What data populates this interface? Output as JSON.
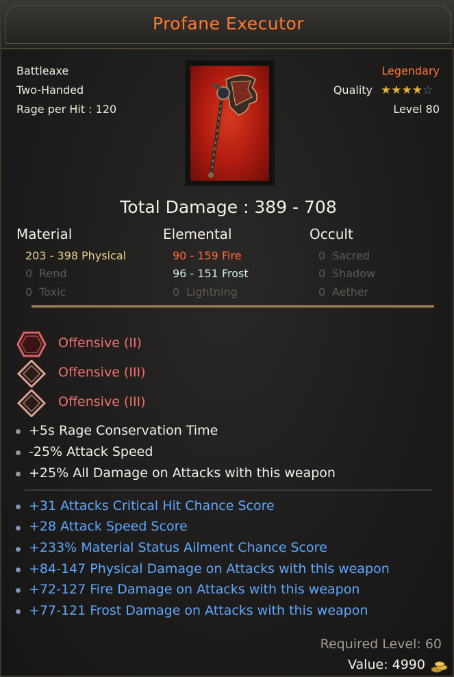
{
  "title": "Profane Executor",
  "item": {
    "type": "Battleaxe",
    "handed": "Two-Handed",
    "rage": "Rage per Hit : 120",
    "rarity": "Legendary",
    "quality_label": "Quality",
    "quality_stars": 4,
    "quality_max": 5,
    "level": "Level 80"
  },
  "total_damage": "Total Damage : 389 - 708",
  "columns": {
    "material": "Material",
    "elemental": "Elemental",
    "occult": "Occult"
  },
  "damage": {
    "physical_val": "203 - 398",
    "physical_name": "Physical",
    "rend_val": "0",
    "rend_name": "Rend",
    "toxic_val": "0",
    "toxic_name": "Toxic",
    "fire_val": "90 - 159",
    "fire_name": "Fire",
    "frost_val": "96 - 151",
    "frost_name": "Frost",
    "lightning_val": "0",
    "lightning_name": "Lightning",
    "sacred_val": "0",
    "sacred_name": "Sacred",
    "shadow_val": "0",
    "shadow_name": "Shadow",
    "aether_val": "0",
    "aether_name": "Aether"
  },
  "sockets": [
    {
      "label": "Offensive (II)",
      "shape": "hexagon"
    },
    {
      "label": "Offensive (III)",
      "shape": "diamond"
    },
    {
      "label": "Offensive (III)",
      "shape": "diamond"
    }
  ],
  "base_mods": [
    "+5s Rage Conservation Time",
    "-25% Attack Speed",
    "+25% All Damage on Attacks with this weapon"
  ],
  "blue_mods": [
    "+31 Attacks Critical Hit Chance Score",
    "+28 Attack Speed Score",
    "+233% Material Status Ailment Chance Score",
    "+84-147 Physical Damage on Attacks with this weapon",
    "+72-127 Fire Damage on Attacks with this weapon",
    "+77-121 Frost Damage on Attacks with this weapon"
  ],
  "required_level": "Required Level: 60",
  "value": "Value: 4990",
  "colors": {
    "legendary": "#ff7a30",
    "fire": "#ff6a3c",
    "frost": "#cdeee0",
    "blue_mod": "#5fa8ff",
    "socket": "#f07070"
  },
  "icons": {
    "coin": "gold-coins-icon",
    "weapon": "battleaxe-image"
  }
}
